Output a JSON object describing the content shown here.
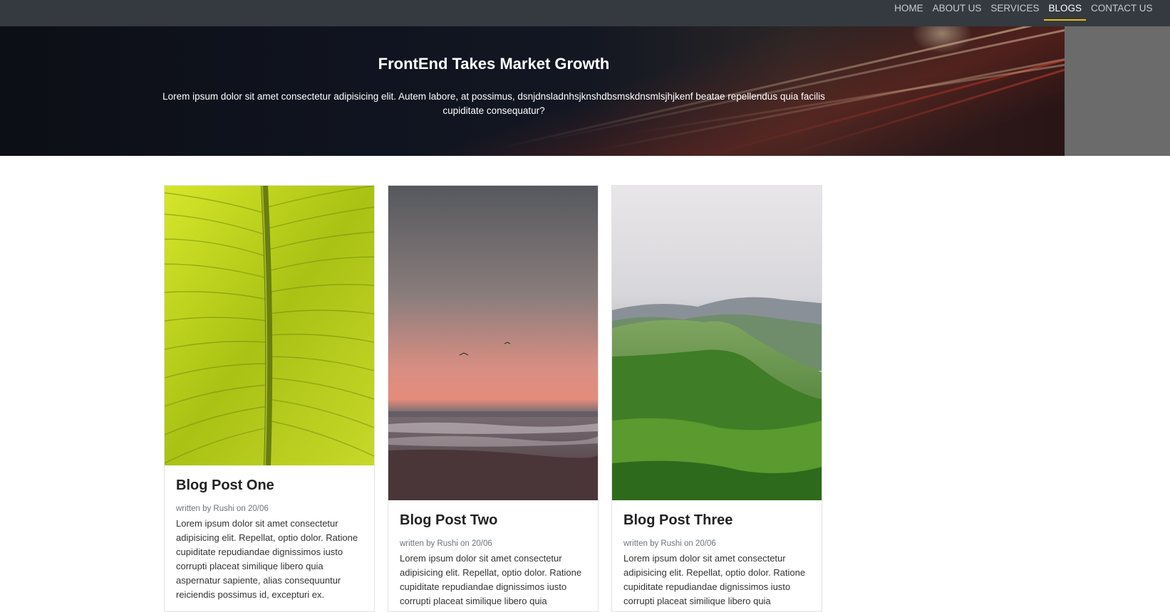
{
  "nav": {
    "items": [
      {
        "label": "HOME",
        "active": false
      },
      {
        "label": "ABOUT US",
        "active": false
      },
      {
        "label": "SERVICES",
        "active": false
      },
      {
        "label": "BLOGS",
        "active": true
      },
      {
        "label": "CONTACT US",
        "active": false
      }
    ],
    "accent_color": "#f0b90b",
    "background_color": "#343a40"
  },
  "hero": {
    "title": "FrontEnd Takes Market Growth",
    "text": "Lorem ipsum dolor sit amet consectetur adipisicing elit. Autem labore, at possimus, dsnjdnsladnhsjknshdbsmskdnsmlsjhjkenf beatae repellendus quia facilis cupiditate consequatur?"
  },
  "posts": [
    {
      "title": "Blog Post One",
      "meta": "written by Rushi on 20/06",
      "text": "Lorem ipsum dolor sit amet consectetur adipisicing elit. Repellat, optio dolor. Ratione cupiditate repudiandae dignissimos iusto corrupti placeat similique libero quia aspernatur sapiente, alias consequuntur reiciendis possimus id, excepturi ex.",
      "image": "banana-leaf-photo"
    },
    {
      "title": "Blog Post Two",
      "meta": "written by Rushi on 20/06",
      "text": "Lorem ipsum dolor sit amet consectetur adipisicing elit. Repellat, optio dolor. Ratione cupiditate repudiandae dignissimos iusto corrupti placeat similique libero quia",
      "image": "sunset-beach-photo"
    },
    {
      "title": "Blog Post Three",
      "meta": "written by Rushi on 20/06",
      "text": "Lorem ipsum dolor sit amet consectetur adipisicing elit. Repellat, optio dolor. Ratione cupiditate repudiandae dignissimos iusto corrupti placeat similique libero quia",
      "image": "green-mountains-photo"
    }
  ]
}
